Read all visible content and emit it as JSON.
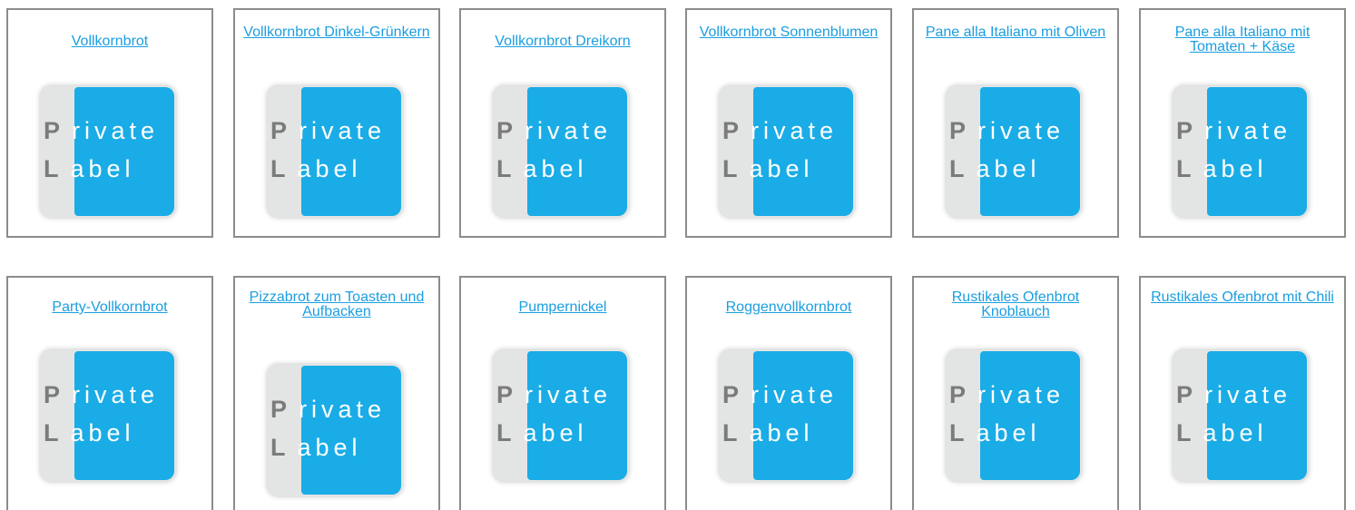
{
  "products": [
    {
      "title": "Vollkornbrot"
    },
    {
      "title": "Vollkornbrot Dinkel-Grünkern"
    },
    {
      "title": "Vollkornbrot Dreikorn"
    },
    {
      "title": "Vollkornbrot Sonnenblumen"
    },
    {
      "title": "Pane alla Italiano mit Oliven"
    },
    {
      "title": "Pane alla Italiano mit Tomaten + Käse"
    },
    {
      "title": "Party-Vollkornbrot"
    },
    {
      "title": "Pizzabrot zum Toasten und Aufbacken"
    },
    {
      "title": "Pumpernickel"
    },
    {
      "title": "Roggenvollkornbrot"
    },
    {
      "title": "Rustikales Ofenbrot Knoblauch"
    },
    {
      "title": "Rustikales Ofenbrot mit Chili"
    }
  ],
  "logo": {
    "line1_initial": "P",
    "line1_rest": "rivate",
    "line2_initial": "L",
    "line2_rest": "abel",
    "colors": {
      "blue": "#1aace6",
      "gray_letters": "#7b7b7b",
      "frame": "#e3e4e4"
    }
  },
  "colors": {
    "link": "#1a9ee0",
    "card_border": "#8c8c8c"
  }
}
